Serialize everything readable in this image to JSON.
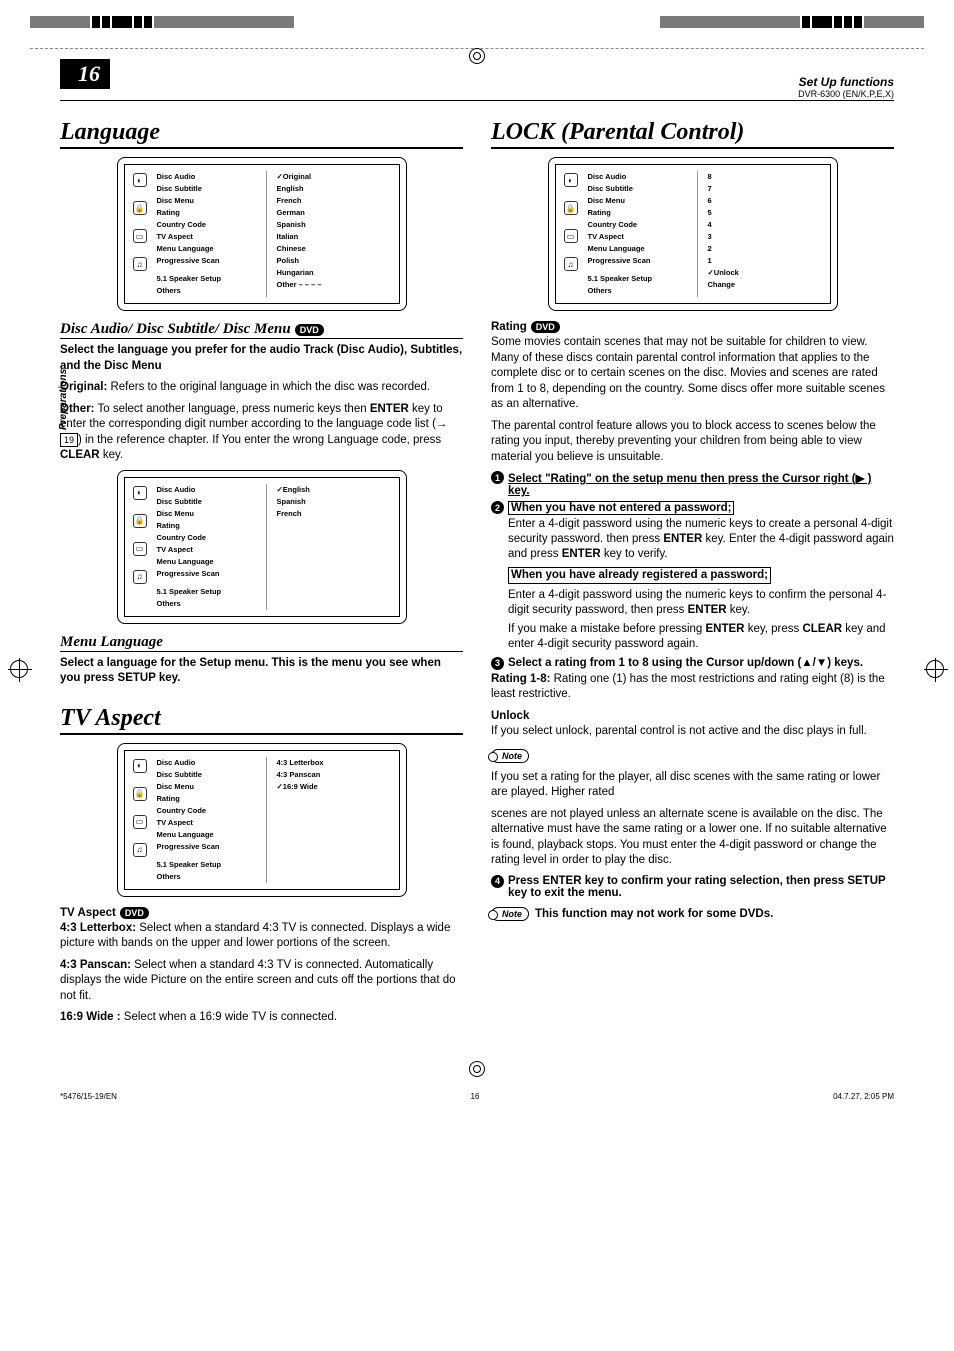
{
  "page": {
    "number": "16",
    "section_label": "Set Up functions",
    "model_line": "DVR-6300 (EN/K,P,E,X)",
    "side_tab": "Preparations",
    "footer_left": "*5476/15-19/EN",
    "footer_center": "16",
    "footer_right": "04.7.27, 2:05 PM"
  },
  "left": {
    "h_language": "Language",
    "menu1": {
      "items": [
        "Disc Audio",
        "Disc Subtitle",
        "Disc Menu",
        "Rating",
        "Country Code",
        "TV Aspect",
        "Menu Language",
        "Progressive Scan",
        "5.1 Speaker Setup",
        "Others"
      ],
      "vals": [
        "✓Original",
        "English",
        "French",
        "German",
        "Spanish",
        "Italian",
        "Chinese",
        "Polish",
        "Hungarian",
        "Other  – – – –"
      ]
    },
    "h_disc": "Disc Audio/ Disc Subtitle/ Disc Menu",
    "disc_bold": "Select the language you prefer for the audio Track (Disc Audio), Subtitles, and the Disc Menu",
    "orig_label": "Original:",
    "orig_text": " Refers to the original language in which the disc was recorded.",
    "other_label": "Other:",
    "other_text_a": " To select another language, press numeric keys then ",
    "enter": "ENTER",
    "other_text_b": " key to enter the corresponding digit number according to the language code list (→",
    "ref19": "19",
    "other_text_c": ") in the reference chapter. If You enter the wrong Language code, press ",
    "clear": "CLEAR",
    "other_text_d": " key.",
    "menu2": {
      "items": [
        "Disc Audio",
        "Disc Subtitle",
        "Disc Menu",
        "Rating",
        "Country Code",
        "TV Aspect",
        "Menu Language",
        "Progressive Scan",
        "5.1 Speaker Setup",
        "Others"
      ],
      "vals": [
        "✓English",
        "Spanish",
        "French"
      ]
    },
    "h_menulang": "Menu Language",
    "menulang_text": "Select a language for the Setup menu. This is the menu you see when you press SETUP key.",
    "h_tvaspect": "TV Aspect",
    "menu3": {
      "items": [
        "Disc Audio",
        "Disc Subtitle",
        "Disc Menu",
        "Rating",
        "Country Code",
        "TV Aspect",
        "Menu Language",
        "Progressive Scan",
        "5.1 Speaker Setup",
        "Others"
      ],
      "vals": [
        "4:3  Letterbox",
        "4:3  Panscan",
        "✓16:9 Wide"
      ]
    },
    "h_tvaspect2": "TV Aspect",
    "lb_label": "4:3 Letterbox:",
    "lb_text": " Select when a standard 4:3 TV is connected. Displays a wide picture with bands on the upper and lower portions of the screen.",
    "ps_label": "4:3 Panscan:",
    "ps_text": " Select when a standard 4:3 TV is connected. Automatically displays the wide Picture on the entire screen and cuts off the portions that do not fit.",
    "wide_label": "16:9 Wide :",
    "wide_text": " Select when a 16:9 wide TV is connected."
  },
  "right": {
    "h_lock": "LOCK (Parental Control)",
    "menu4": {
      "items": [
        "Disc Audio",
        "Disc Subtitle",
        "Disc Menu",
        "Rating",
        "Country Code",
        "TV Aspect",
        "Menu Language",
        "Progressive Scan",
        "5.1 Speaker Setup",
        "Others"
      ],
      "vals": [
        "8",
        "7",
        "6",
        "5",
        "4",
        "3",
        "2",
        "1",
        "✓Unlock",
        "Change"
      ]
    },
    "h_rating": "Rating",
    "rating_p1": "Some movies contain scenes that may not be suitable for children to view. Many of these discs contain parental control information that applies to the complete disc or to certain scenes on the disc. Movies and scenes are rated from 1 to  8,   depending on the country. Some discs offer more suitable scenes as an alternative.",
    "rating_p2": "The parental control feature allows you to block access to scenes below the rating you input, thereby preventing your children from being able to view material you believe is unsuitable.",
    "step1": "Select \"Rating\" on the setup menu then press the Cursor right (▶ ) key.",
    "step2_box": "When you have not entered a password;",
    "step2_a": "Enter a 4-digit password using the numeric keys to create a personal 4-digit security password. then press ",
    "step2_b": " key. Enter the 4-digit password again and press ",
    "step2_c": " key to verify.",
    "step2_box2": "When you have already registered a password;",
    "step2_d": "Enter a 4-digit password using the numeric keys to confirm the personal 4-digit security password, then press ",
    "step2_e": " key.",
    "step2_f": "If you make a mistake before pressing ",
    "step2_g": " key, press ",
    "step2_h": " key and enter 4-digit security password again.",
    "step3": "Select a rating from 1 to 8 using the Cursor up/down (▲/▼) keys.",
    "rating18_label": "Rating 1-8:",
    "rating18_text": " Rating one (1) has the most restrictions and rating eight (8) is the least restrictive.",
    "unlock_label": "Unlock",
    "unlock_text": "If you select unlock, parental control is not active and the disc plays in full.",
    "note_label": "Note",
    "note1": "If you set a rating for the player, all disc scenes with the same rating or lower are played. Higher rated",
    "note1b": "scenes are not played unless an alternate scene is available on the disc. The alternative must have the same rating or a lower one. If no suitable alternative is found, playback stops. You must enter the 4-digit password or change the rating level in order to play the disc.",
    "step4": "Press ENTER key to confirm your rating selection, then press SETUP key to exit the menu.",
    "note2": "This function may not work for some DVDs."
  }
}
